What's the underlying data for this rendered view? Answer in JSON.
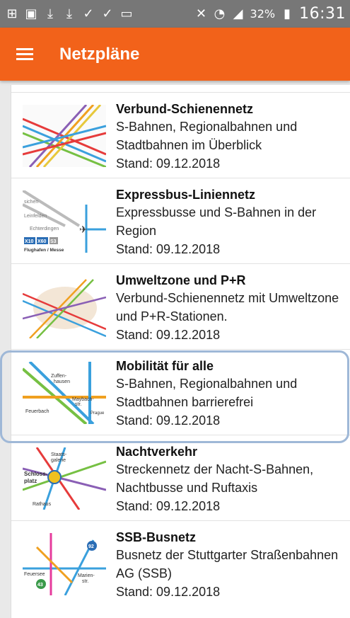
{
  "status": {
    "battery": "32%",
    "time": "16:31",
    "icons": [
      "add-box-icon",
      "image-icon",
      "download-icon",
      "download-icon",
      "check-icon",
      "check-icon",
      "message-icon",
      "mute-icon",
      "wifi-icon",
      "signal-icon",
      "battery-icon"
    ]
  },
  "appbar": {
    "title": "Netzpläne"
  },
  "colors": {
    "accent": "#f2621a",
    "statusbar": "#777777",
    "highlight": "#9fb8d7"
  },
  "items": [
    {
      "title": "Verbund-Schienennetz",
      "description": "S-Bahnen, Regionalbahnen und Stadtbahnen im Überblick",
      "date": "Stand: 09.12.2018"
    },
    {
      "title": "Expressbus-Liniennetz",
      "description": "Expressbusse und S-Bahnen in der Region",
      "date": "Stand: 09.12.2018"
    },
    {
      "title": "Umweltzone und P+R",
      "description": "Verbund-Schienennetz mit Umweltzone und P+R-Stationen.",
      "date": "Stand: 09.12.2018"
    },
    {
      "title": "Mobilität für alle",
      "description": "S-Bahnen, Regionalbahnen und Stadtbahnen barrierefrei",
      "date": "Stand: 09.12.2018"
    },
    {
      "title": "Nachtverkehr",
      "description": "Streckennetz der Nacht-S-Bahnen, Nachtbusse und Ruftaxis",
      "date": "Stand: 09.12.2018"
    },
    {
      "title": "SSB-Busnetz",
      "description": "Busnetz der Stuttgarter Straßenbahnen AG (SSB)",
      "date": "Stand: 09.12.2018"
    }
  ],
  "thumb_labels": {
    "item2": [
      "sichen",
      "Leinfelden",
      "Echterdingen",
      "X10",
      "X60",
      "S3",
      "Flughafen / Messe"
    ],
    "item4": [
      "Zuffen-",
      "hausen",
      "Maybach-",
      "str.",
      "Feuerbach",
      "Prague"
    ],
    "item5": [
      "Staats-",
      "galerie",
      "Schloss-",
      "platz",
      "Rathaus"
    ],
    "item6": [
      "Feuersee",
      "Marien-",
      "str.",
      "43",
      "92"
    ]
  }
}
